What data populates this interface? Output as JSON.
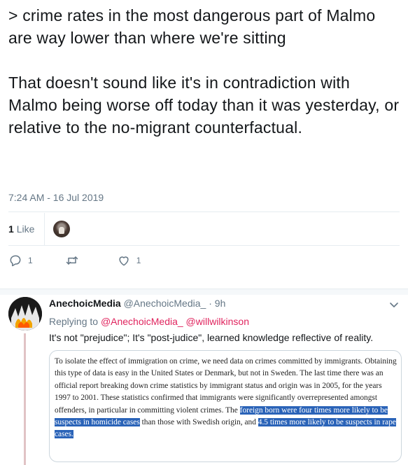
{
  "main_tweet": {
    "text": "> crime rates in the most dangerous part of Malmo are way lower than where we're sitting\n\nThat doesn't sound like it's in contradiction with Malmo being worse off today than it was yesterday, or relative to the no-migrant counterfactual.",
    "timestamp": "7:24 AM - 16 Jul 2019",
    "like_count": "1",
    "like_label": "Like",
    "actions": {
      "reply_count": "1",
      "retweet_count": "",
      "like_count": "1"
    }
  },
  "reply": {
    "display_name": "AnechoicMedia",
    "handle": "@AnechoicMedia_",
    "dot": "·",
    "time": "9h",
    "replying_prefix": "Replying to",
    "replying_to": "@AnechoicMedia_ @willwilkinson",
    "text": "It's not \"prejudice\"; It's \"post-judice\", learned knowledge reflective of reality.",
    "quote": {
      "part1": "To isolate the effect of immigration on crime, we need data on crimes committed by immigrants. Obtaining this type of data is easy in the United States or Denmark, but not in Sweden. The last time there was an official report breaking down crime statistics by immigrant status and origin was in 2005, for the years 1997 to 2001. These statistics confirmed that immigrants were significantly overrepresented amongst offenders, in particular in committing violent crimes. The ",
      "highlight1": "foreign born were four times more likely to be suspects in homicide cases",
      "part2": " than those with Swedish origin, and ",
      "highlight2": "4.5 times more likely to be suspects in rape cases."
    }
  },
  "colors": {
    "text_primary": "#14171a",
    "text_secondary": "#657786",
    "mention": "#e0245e",
    "highlight": "#2a63b8",
    "thread_line": "#e1c3c5"
  },
  "icons": [
    "reply-icon",
    "retweet-icon",
    "heart-icon",
    "chevron-down-icon"
  ]
}
